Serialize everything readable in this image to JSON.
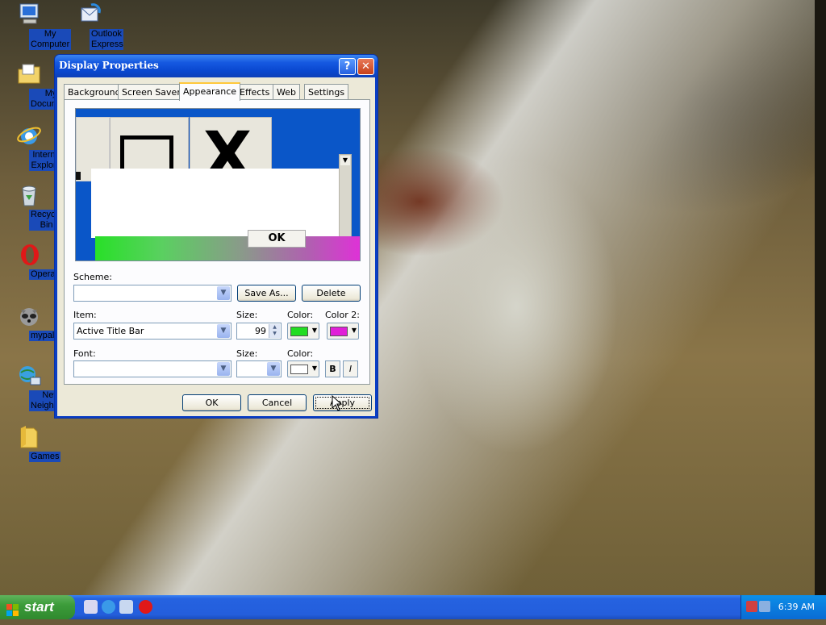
{
  "desktop": {
    "icons": [
      {
        "label": "My Computer",
        "icon": "computer-icon"
      },
      {
        "label": "Outlook Express",
        "icon": "outlook-icon"
      },
      {
        "label": "My Document",
        "icon": "folder-icon"
      },
      {
        "label": "Internet Explorer",
        "icon": "ie-icon"
      },
      {
        "label": "Recycle Bin",
        "icon": "recycle-bin-icon"
      },
      {
        "label": "Opera",
        "icon": "opera-icon"
      },
      {
        "label": "mypal",
        "icon": "raccoon-icon"
      },
      {
        "label": "Network Neighborhood",
        "icon": "network-icon"
      },
      {
        "label": "Games",
        "icon": "folder-icon"
      }
    ]
  },
  "dialog": {
    "title": "Display Properties",
    "help_glyph": "?",
    "close_glyph": "✕",
    "tabs": [
      "Background",
      "Screen Saver",
      "Appearance",
      "Effects",
      "Web",
      "Settings"
    ],
    "active_tab": "Appearance",
    "preview": {
      "ok_label": "OK",
      "close_glyph": "X"
    },
    "scheme": {
      "label": "Scheme:",
      "value": "",
      "save_as": "Save As...",
      "delete": "Delete"
    },
    "item": {
      "label": "Item:",
      "value": "Active Title Bar",
      "size_label": "Size:",
      "size_value": "99",
      "color_label": "Color:",
      "color": "#22dd22",
      "color2_label": "Color 2:",
      "color2": "#e020d8"
    },
    "font": {
      "label": "Font:",
      "value": "",
      "size_label": "Size:",
      "size_value": "",
      "color_label": "Color:",
      "color": "#ffffff",
      "bold": "B",
      "italic": "I"
    },
    "buttons": {
      "ok": "OK",
      "cancel": "Cancel",
      "apply": "Apply"
    }
  },
  "taskbar": {
    "start_label": "start",
    "clock": "6:39 AM"
  }
}
